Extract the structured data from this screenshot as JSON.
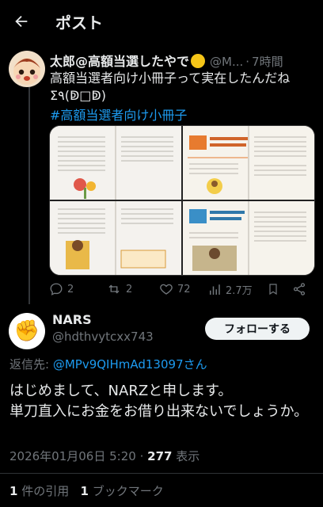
{
  "header": {
    "title": "ポスト",
    "back_icon": "back-arrow-icon"
  },
  "quoted_post": {
    "display_name": "太郎@高額当選したやで",
    "handle": "@M...",
    "separator": "·",
    "time": "7時間",
    "text": "高額当選者向け小冊子って実在したんだね\nΣ٩(ↁ□ↁ)",
    "hashtag": "#高額当選者向け小冊子",
    "stats": {
      "replies": "2",
      "reposts": "2",
      "likes": "72",
      "views": "2.7万"
    }
  },
  "reply_post": {
    "display_name": "NARS",
    "handle": "@hdthvytcxx743",
    "follow_label": "フォローする",
    "reply_to_label": "返信先:",
    "reply_to_handle": "@MPv9QIHmAd13097さん",
    "text": "はじめまして、NARZと申します。\n単刀直入にお金をお借り出来ないでしょうか。",
    "date": "2026年01月06日 5:20",
    "separator": "·",
    "views": "277",
    "views_label": "表示"
  },
  "footer_stats": {
    "quotes_count": "1",
    "quotes_label": "件の引用",
    "bookmarks_count": "1",
    "bookmarks_label": "ブックマーク"
  },
  "colors": {
    "background": "#000000",
    "accent": "#1d9bf0",
    "text": "#e7e9ea",
    "muted": "#71767b"
  }
}
